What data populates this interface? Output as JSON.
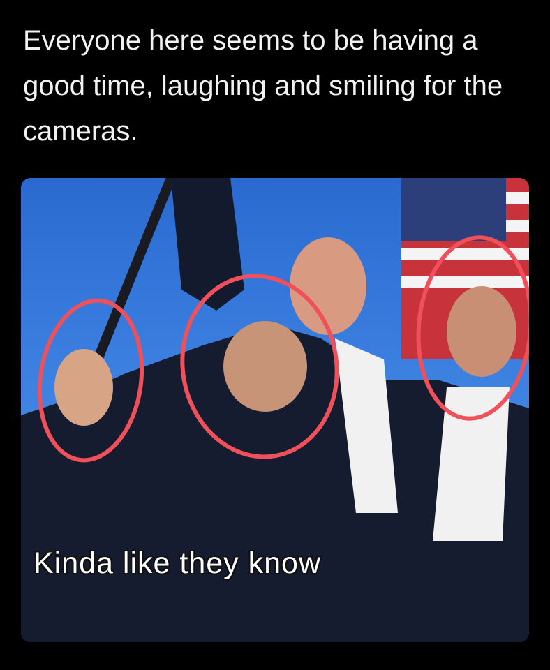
{
  "post": {
    "text": "Everyone here seems to be having a good time, laughing and smiling for the cameras."
  },
  "photo": {
    "caption": "Kinda like they know",
    "annotation_color": "#f0505a",
    "sky_color": "#3b7fe0"
  }
}
